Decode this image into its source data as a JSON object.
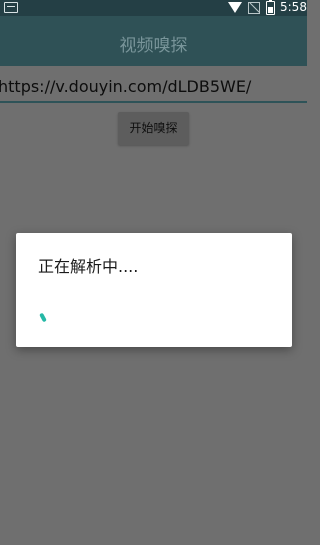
{
  "status_bar": {
    "time": "5:58"
  },
  "app_bar": {
    "title": "视频嗅探"
  },
  "url_input": {
    "value": "https://v.douyin.com/dLDB5WE/"
  },
  "sniff_button": {
    "label": "开始嗅探"
  },
  "dialog": {
    "message": "正在解析中....",
    "spinner_color": "#25b8a6"
  },
  "colors": {
    "status_bar": "#243f45",
    "app_bar": "#2f5156",
    "scrim_background": "#6f6f6f",
    "accent_underline": "#2e5358"
  },
  "icons": [
    "keyboard-icon",
    "wifi-icon",
    "no-signal-icon",
    "battery-icon"
  ]
}
